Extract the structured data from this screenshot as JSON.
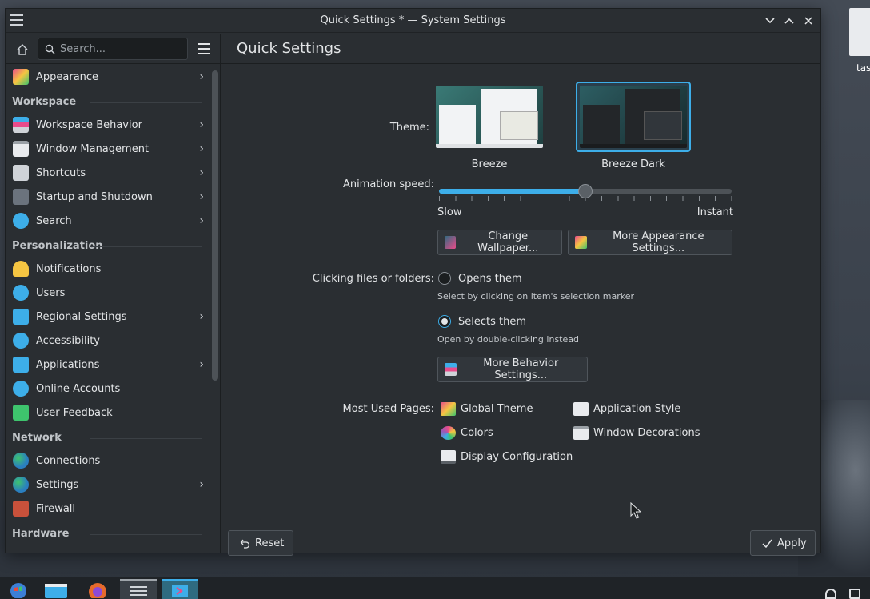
{
  "window": {
    "title": "Quick Settings * — System Settings",
    "controls": [
      "minimize",
      "maximize",
      "close"
    ]
  },
  "sidebar": {
    "search_placeholder": "Search...",
    "top_item": {
      "label": "Appearance",
      "icon": "appearance-icon",
      "has_children": true
    },
    "sections": [
      {
        "title": "Workspace",
        "items": [
          {
            "label": "Workspace Behavior",
            "icon": "workspace-behavior-icon",
            "has_children": true
          },
          {
            "label": "Window Management",
            "icon": "window-management-icon",
            "has_children": true
          },
          {
            "label": "Shortcuts",
            "icon": "keyboard-icon",
            "has_children": true
          },
          {
            "label": "Startup and Shutdown",
            "icon": "startup-icon",
            "has_children": true
          },
          {
            "label": "Search",
            "icon": "search-icon",
            "has_children": true
          }
        ]
      },
      {
        "title": "Personalization",
        "items": [
          {
            "label": "Notifications",
            "icon": "bell-icon",
            "has_children": false
          },
          {
            "label": "Users",
            "icon": "users-icon",
            "has_children": false
          },
          {
            "label": "Regional Settings",
            "icon": "regional-icon",
            "has_children": true
          },
          {
            "label": "Accessibility",
            "icon": "accessibility-icon",
            "has_children": false
          },
          {
            "label": "Applications",
            "icon": "applications-icon",
            "has_children": true
          },
          {
            "label": "Online Accounts",
            "icon": "online-accounts-icon",
            "has_children": false
          },
          {
            "label": "User Feedback",
            "icon": "feedback-icon",
            "has_children": false
          }
        ]
      },
      {
        "title": "Network",
        "items": [
          {
            "label": "Connections",
            "icon": "globe-icon",
            "has_children": false
          },
          {
            "label": "Settings",
            "icon": "globe-icon",
            "has_children": true
          },
          {
            "label": "Firewall",
            "icon": "firewall-icon",
            "has_children": false
          }
        ]
      },
      {
        "title": "Hardware",
        "items": []
      }
    ]
  },
  "main": {
    "page_title": "Quick Settings",
    "theme": {
      "label": "Theme:",
      "options": [
        {
          "name": "Breeze",
          "selected": false
        },
        {
          "name": "Breeze Dark",
          "selected": true
        }
      ]
    },
    "animation": {
      "label": "Animation speed:",
      "min_label": "Slow",
      "max_label": "Instant",
      "value_fraction": 0.5
    },
    "buttons": {
      "change_wallpaper": "Change Wallpaper...",
      "more_appearance": "More Appearance Settings...",
      "more_behavior": "More Behavior Settings..."
    },
    "clicking": {
      "label": "Clicking files or folders:",
      "options": [
        {
          "label": "Opens them",
          "hint": "Select by clicking on item's selection marker",
          "checked": false
        },
        {
          "label": "Selects them",
          "hint": "Open by double-clicking instead",
          "checked": true
        }
      ]
    },
    "most_used": {
      "label": "Most Used Pages:",
      "pages": [
        "Global Theme",
        "Application Style",
        "Colors",
        "Window Decorations",
        "Display Configuration"
      ]
    },
    "footer": {
      "reset": "Reset",
      "apply": "Apply"
    }
  },
  "desktop": {
    "icon_label": "tas"
  },
  "colors": {
    "accent": "#3daee9",
    "window_bg": "#2a2e32",
    "text": "#e3e5e7"
  }
}
